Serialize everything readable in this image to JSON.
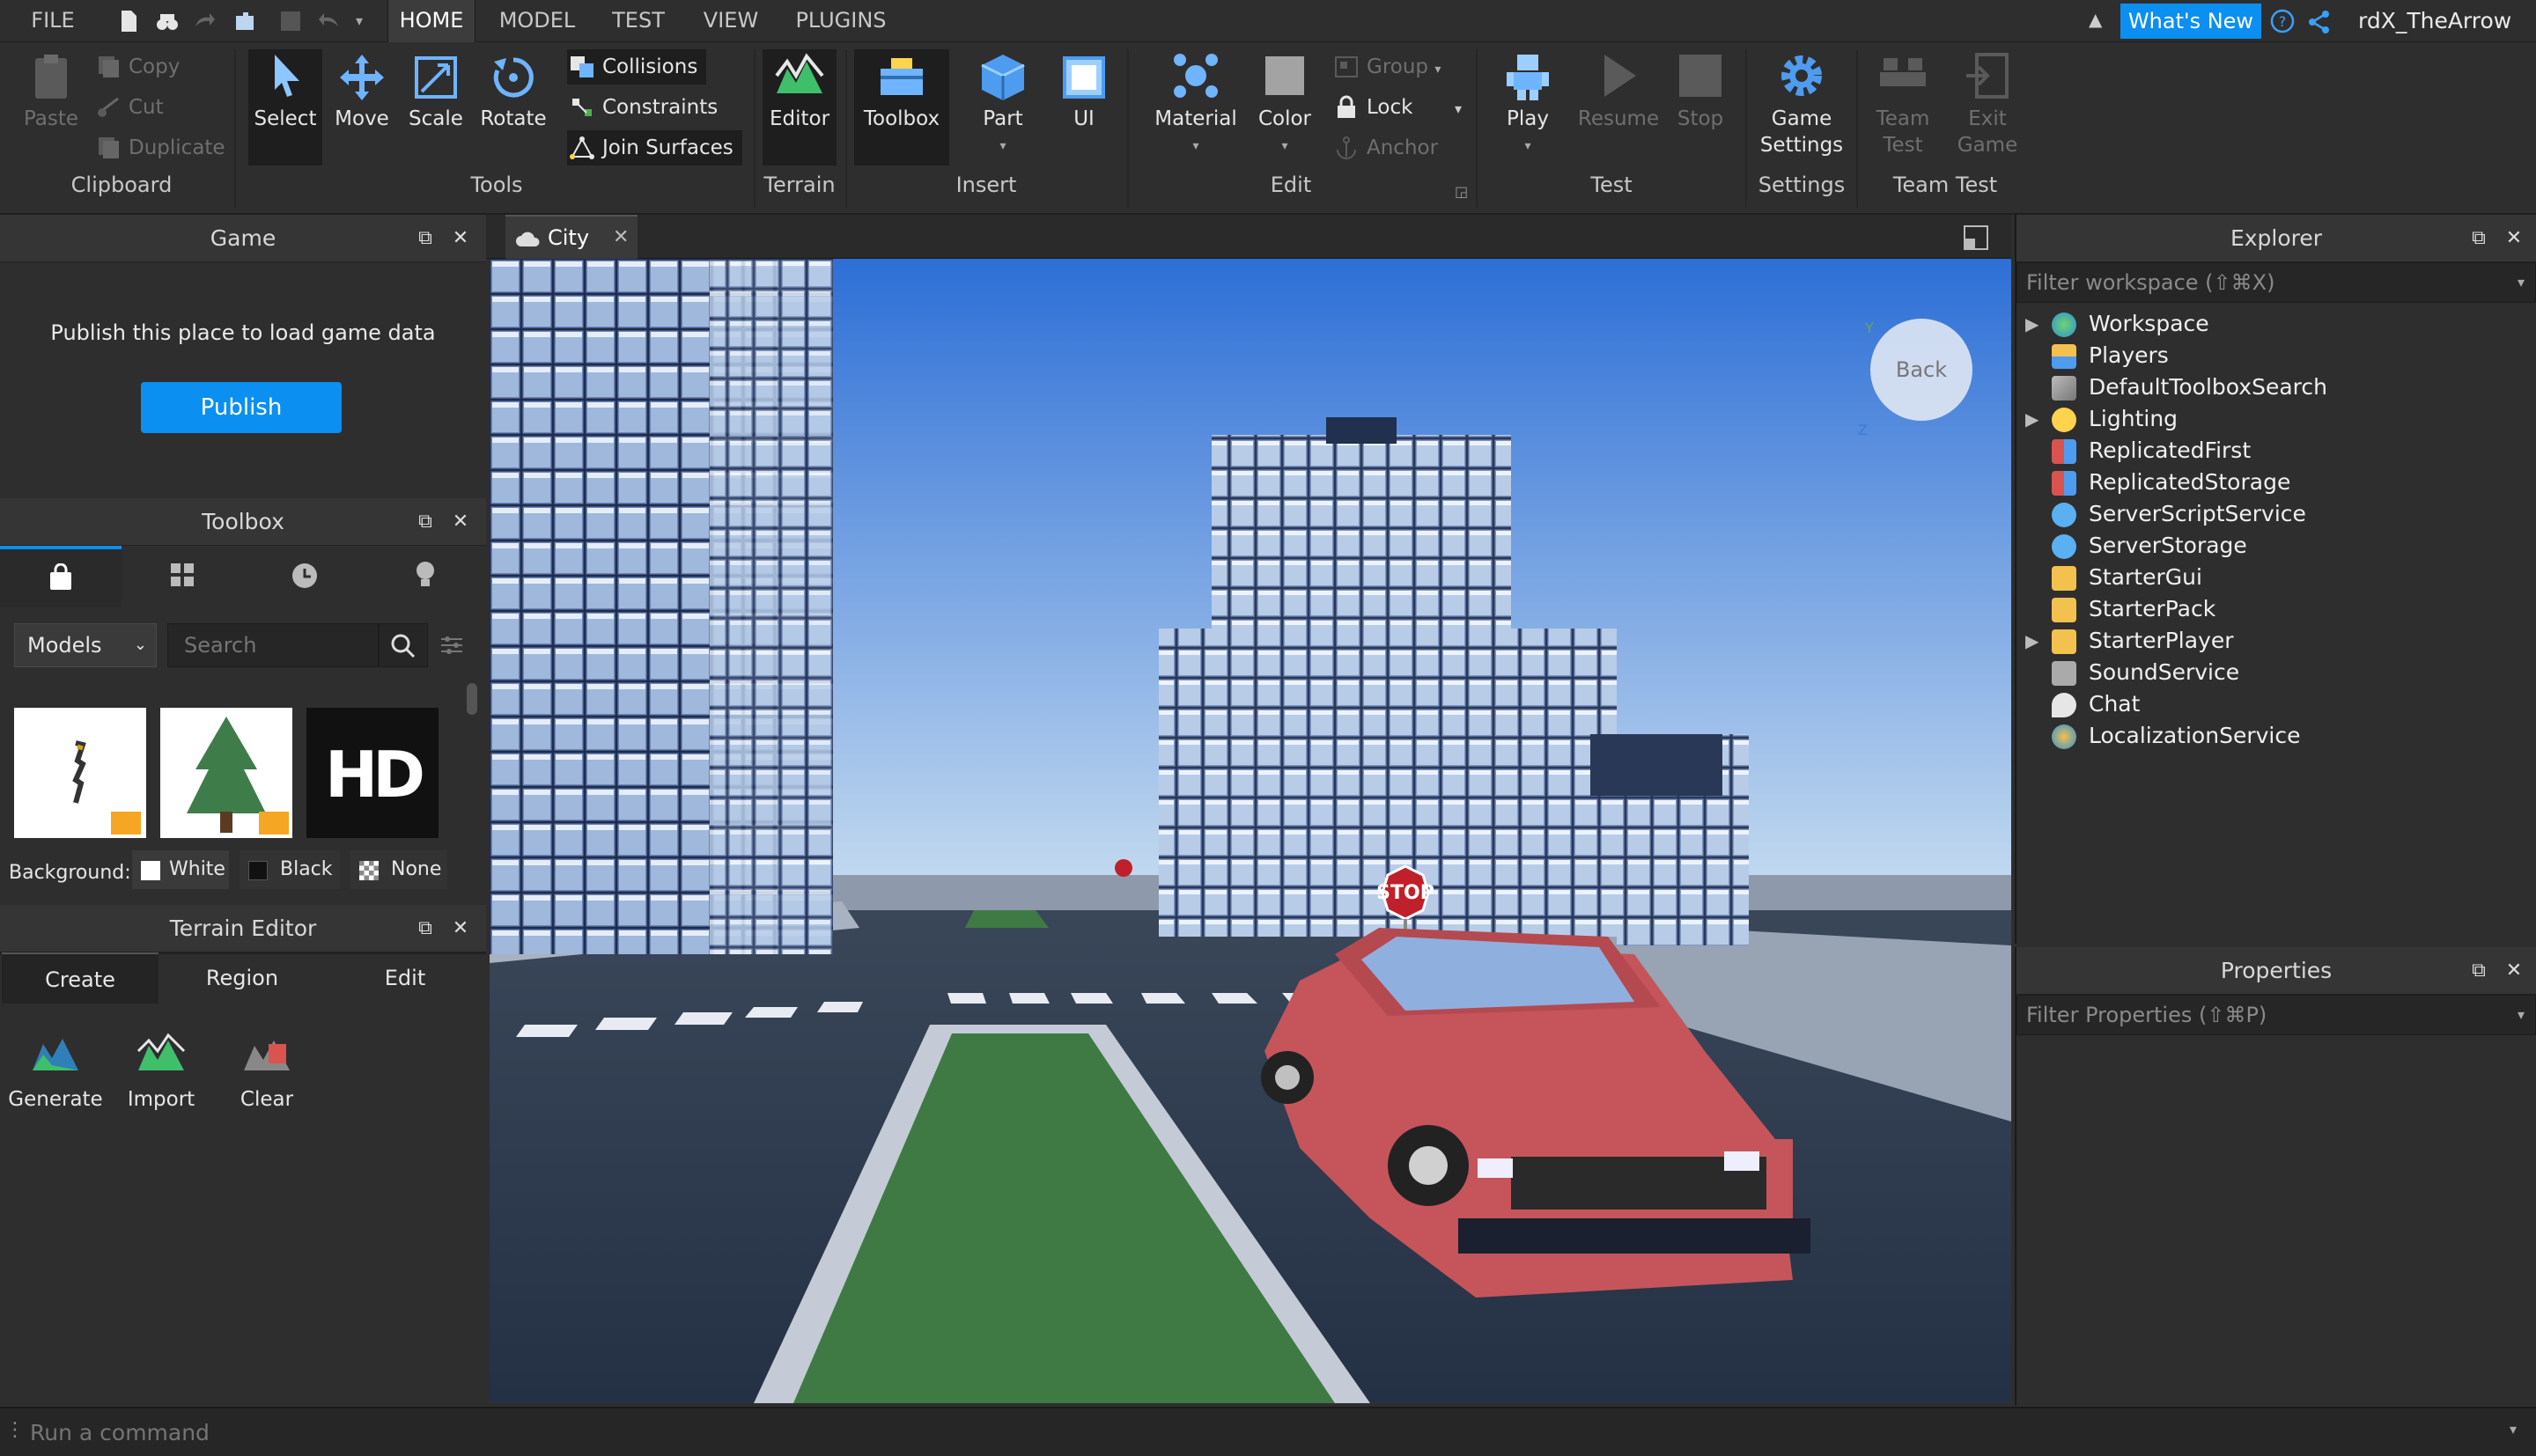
{
  "menu": {
    "file": "FILE",
    "tabs": [
      "HOME",
      "MODEL",
      "TEST",
      "VIEW",
      "PLUGINS"
    ],
    "active_tab": "HOME",
    "whats_new": "What's New",
    "username": "rdX_TheArrow"
  },
  "ribbon": {
    "clipboard": {
      "paste": "Paste",
      "copy": "Copy",
      "cut": "Cut",
      "duplicate": "Duplicate",
      "label": "Clipboard"
    },
    "tools": {
      "select": "Select",
      "move": "Move",
      "scale": "Scale",
      "rotate": "Rotate",
      "collisions": "Collisions",
      "constraints": "Constraints",
      "join_surfaces": "Join Surfaces",
      "label": "Tools"
    },
    "terrain": {
      "editor": "Editor",
      "label": "Terrain"
    },
    "insert": {
      "toolbox": "Toolbox",
      "part": "Part",
      "ui": "UI",
      "label": "Insert"
    },
    "edit": {
      "material": "Material",
      "color": "Color",
      "group": "Group",
      "lock": "Lock",
      "anchor": "Anchor",
      "label": "Edit"
    },
    "test": {
      "play": "Play",
      "resume": "Resume",
      "stop": "Stop",
      "label": "Test"
    },
    "settings": {
      "game_settings_1": "Game",
      "game_settings_2": "Settings",
      "label": "Settings"
    },
    "team_test": {
      "team_1": "Team",
      "team_2": "Test",
      "exit_1": "Exit",
      "exit_2": "Game",
      "label": "Team Test"
    }
  },
  "game_panel": {
    "title": "Game",
    "message": "Publish this place to load game data",
    "publish": "Publish"
  },
  "toolbox_panel": {
    "title": "Toolbox",
    "category": "Models",
    "search_placeholder": "Search",
    "background_label": "Background:",
    "bg_options": [
      "White",
      "Black",
      "None"
    ],
    "hd_tile": "HD"
  },
  "terrain_panel": {
    "title": "Terrain Editor",
    "tabs": [
      "Create",
      "Region",
      "Edit"
    ],
    "tools": [
      "Generate",
      "Import",
      "Clear"
    ]
  },
  "viewport": {
    "tab_name": "City",
    "view_cube": "Back",
    "axis_y": "Y",
    "axis_z": "Z",
    "stop_sign": "STOP"
  },
  "explorer": {
    "title": "Explorer",
    "filter": "Filter workspace (⇧⌘X)",
    "items": [
      "Workspace",
      "Players",
      "DefaultToolboxSearch",
      "Lighting",
      "ReplicatedFirst",
      "ReplicatedStorage",
      "ServerScriptService",
      "ServerStorage",
      "StarterGui",
      "StarterPack",
      "StarterPlayer",
      "SoundService",
      "Chat",
      "LocalizationService"
    ]
  },
  "properties": {
    "title": "Properties",
    "filter": "Filter Properties (⇧⌘P)"
  },
  "command_bar": {
    "placeholder": "Run a command"
  },
  "colors": {
    "accent": "#0b8ff0",
    "bg": "#2e2e2e",
    "panel_header": "#353535"
  }
}
